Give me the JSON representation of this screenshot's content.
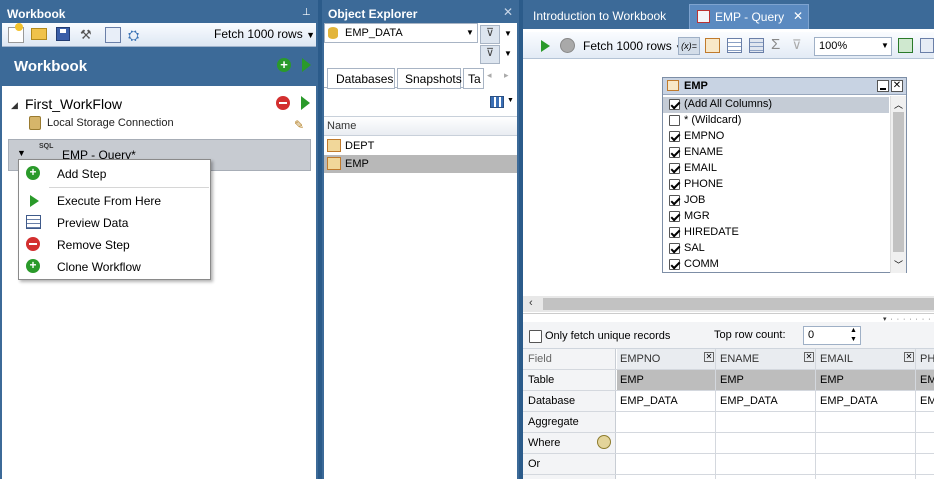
{
  "workbook": {
    "panel_title": "Workbook",
    "fetch_label": "Fetch 1000 rows",
    "header": "Workbook",
    "workflow_name": "First_WorkFlow",
    "connection": "Local Storage Connection",
    "step_name": "EMP - Query*",
    "step_icon_text": "SQL"
  },
  "context_menu": {
    "items": [
      {
        "label": "Add Step"
      },
      {
        "label": "Execute From Here"
      },
      {
        "label": "Preview Data"
      },
      {
        "label": "Remove Step"
      },
      {
        "label": "Clone Workflow"
      }
    ]
  },
  "explorer": {
    "title": "Object Explorer",
    "selected_db": "EMP_DATA",
    "tabs": [
      "Databases",
      "Snapshots",
      "Ta"
    ],
    "column_header": "Name",
    "items": [
      "DEPT",
      "EMP"
    ]
  },
  "tabs": {
    "intro": "Introduction to Workbook",
    "query": "EMP - Query"
  },
  "query_toolbar": {
    "fetch_label": "Fetch 1000 rows",
    "fx_label": "(x)=",
    "zoom": "100%"
  },
  "emp_box": {
    "title": "EMP",
    "columns": [
      {
        "label": "(Add All Columns)",
        "checked": true
      },
      {
        "label": "* (Wildcard)",
        "checked": false
      },
      {
        "label": "EMPNO",
        "checked": true
      },
      {
        "label": "ENAME",
        "checked": true
      },
      {
        "label": "EMAIL",
        "checked": true
      },
      {
        "label": "PHONE",
        "checked": true
      },
      {
        "label": "JOB",
        "checked": true
      },
      {
        "label": "MGR",
        "checked": true
      },
      {
        "label": "HIREDATE",
        "checked": true
      },
      {
        "label": "SAL",
        "checked": true
      },
      {
        "label": "COMM",
        "checked": true
      }
    ]
  },
  "grid_options": {
    "unique_label": "Only fetch unique records",
    "top_row_label": "Top row count:",
    "top_row_value": "0"
  },
  "grid": {
    "row_labels": [
      "Field",
      "Table",
      "Database",
      "Aggregate",
      "Where",
      "Or"
    ],
    "columns": [
      {
        "name": "EMPNO",
        "table": "EMP",
        "database": "EMP_DATA"
      },
      {
        "name": "ENAME",
        "table": "EMP",
        "database": "EMP_DATA"
      },
      {
        "name": "EMAIL",
        "table": "EMP",
        "database": "EMP_DATA"
      },
      {
        "name": "PHO",
        "table": "EM",
        "database": "EM"
      }
    ]
  },
  "colors": {
    "frame": "#2b5b8a",
    "header_light": "#c9d9ec",
    "accent_green": "#2a9a2a",
    "accent_red": "#d32f2f"
  }
}
